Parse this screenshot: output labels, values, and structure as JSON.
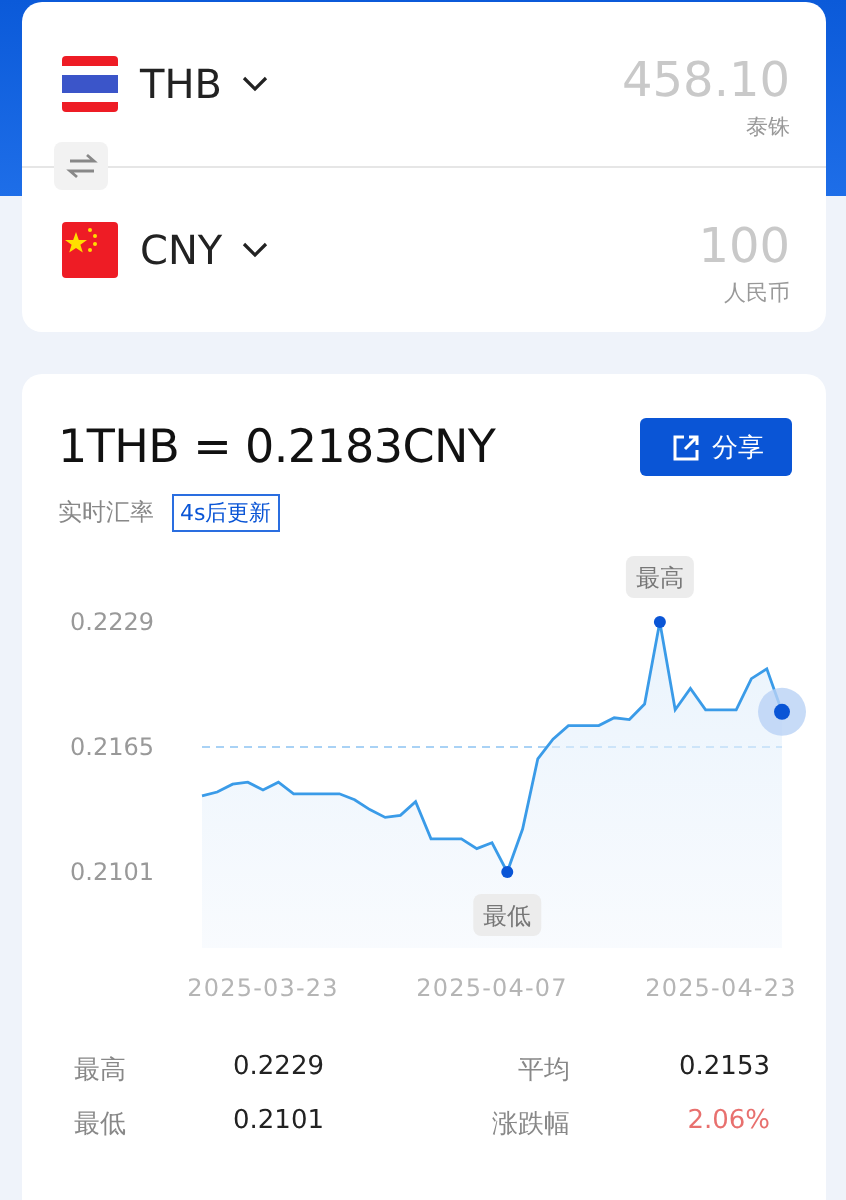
{
  "converter": {
    "currencies": [
      {
        "code": "THB",
        "kind": "thailand",
        "amount": "458.10",
        "name": "泰铢"
      },
      {
        "code": "CNY",
        "kind": "china",
        "amount": "100",
        "name": "人民币"
      }
    ]
  },
  "rate": {
    "title": "1THB = 0.2183CNY",
    "share_button": "分享",
    "subtitle": "实时汇率",
    "update_badge": "4s后更新"
  },
  "chart": {
    "chart_data": {
      "type": "area",
      "categories": [
        null,
        null,
        null,
        null,
        "2025-03-23",
        null,
        null,
        null,
        null,
        null,
        null,
        null,
        null,
        null,
        null,
        null,
        null,
        null,
        null,
        "2025-04-07",
        null,
        null,
        null,
        null,
        null,
        null,
        null,
        null,
        null,
        null,
        null,
        null,
        null,
        null,
        "2025-04-23",
        null,
        null,
        null,
        null
      ],
      "series": [
        {
          "color": "#3a9be8",
          "values": [
            0.214,
            0.2142,
            0.2146,
            0.2147,
            0.2143,
            0.2147,
            0.2141,
            0.2141,
            0.2141,
            0.2141,
            0.2138,
            0.2133,
            0.2129,
            0.213,
            0.2137,
            0.2118,
            0.2118,
            0.2118,
            0.2113,
            0.2116,
            0.2101,
            0.2123,
            0.2159,
            0.2169,
            0.2176,
            0.2176,
            0.2176,
            0.218,
            0.2179,
            0.2187,
            0.2229,
            0.2184,
            0.2195,
            0.2184,
            0.2184,
            0.2184,
            0.22,
            0.2205,
            0.2183
          ]
        }
      ],
      "ylim": [
        0.2101,
        0.2229
      ],
      "ref_lines": [
        {
          "axis": "y",
          "value": 0.2165
        }
      ],
      "yticks": [
        {
          "value": 0.2229,
          "label": "0.2229"
        },
        {
          "value": 0.2165,
          "label": "0.2165"
        },
        {
          "value": 0.2101,
          "label": "0.2101"
        }
      ],
      "annotations": [
        {
          "text": "最高",
          "y": 0.2229
        },
        {
          "text": "最低",
          "y": 0.2101
        }
      ]
    }
  },
  "stats": [
    {
      "label": "最高",
      "value": "0.2229",
      "color": "#222222"
    },
    {
      "label": "平均",
      "value": "0.2153",
      "color": "#222222"
    },
    {
      "label": "最低",
      "value": "0.2101",
      "color": "#222222"
    },
    {
      "label": "涨跌幅",
      "value": "2.06%",
      "color": "#e8706e"
    }
  ]
}
